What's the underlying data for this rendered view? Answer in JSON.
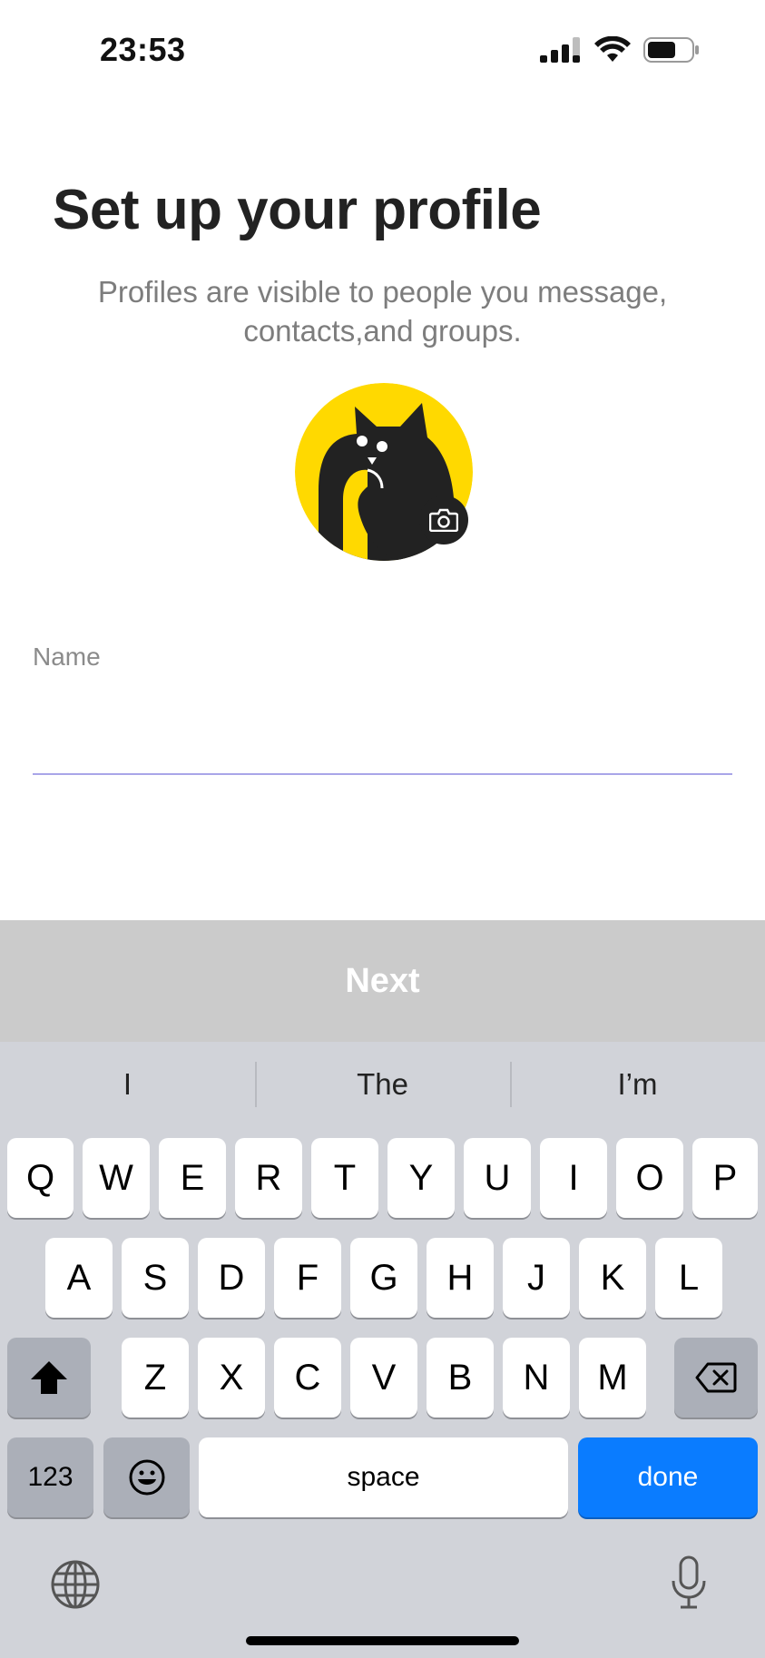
{
  "status_bar": {
    "time": "23:53",
    "icons": [
      "signal-icon",
      "wifi-icon",
      "battery-icon"
    ]
  },
  "header": {
    "title": "Set up your profile",
    "subtitle": "Profiles are visible to people you message, contacts,and groups."
  },
  "avatar": {
    "icon": "cat-avatar-icon",
    "badge_icon": "camera-icon",
    "colors": {
      "background": "#FFD900",
      "cat": "#222222"
    }
  },
  "name_field": {
    "label": "Name",
    "value": "",
    "accent_color": "#A9A5E8"
  },
  "next_button": {
    "label": "Next",
    "background": "#CBCBCB"
  },
  "keyboard": {
    "suggestions": [
      "I",
      "The",
      "I’m"
    ],
    "row1": [
      "Q",
      "W",
      "E",
      "R",
      "T",
      "Y",
      "U",
      "I",
      "O",
      "P"
    ],
    "row2": [
      "A",
      "S",
      "D",
      "F",
      "G",
      "H",
      "J",
      "K",
      "L"
    ],
    "row3": [
      "Z",
      "X",
      "C",
      "V",
      "B",
      "N",
      "M"
    ],
    "numbers_key": "123",
    "space_key": "space",
    "done_key": "done",
    "done_color": "#0A7CFF",
    "icons": [
      "shift-icon",
      "backspace-icon",
      "emoji-icon",
      "globe-icon",
      "microphone-icon"
    ]
  }
}
